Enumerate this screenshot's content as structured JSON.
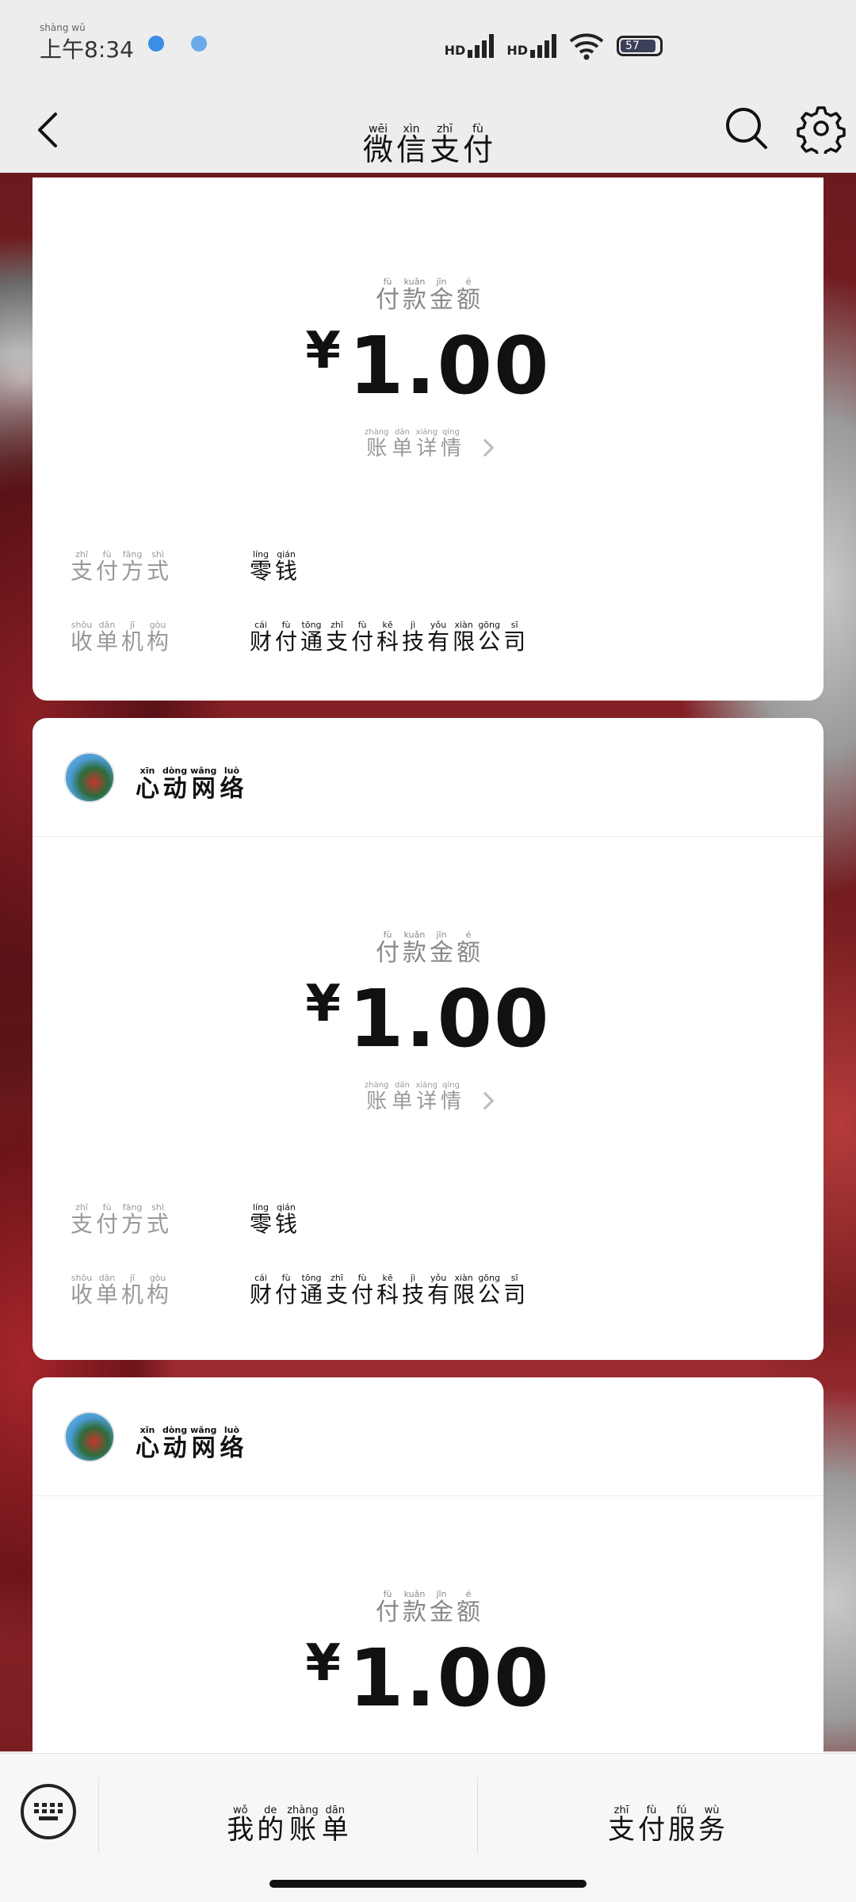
{
  "status_bar": {
    "time_pinyin": "shàng wǔ",
    "time": "上午8:34",
    "signal_1": "HD",
    "signal_2": "HD",
    "battery": "57"
  },
  "nav": {
    "title_chars": [
      {
        "py": "wēi",
        "hz": "微"
      },
      {
        "py": "xìn",
        "hz": "信"
      },
      {
        "py": "zhī",
        "hz": "支"
      },
      {
        "py": "fù",
        "hz": "付"
      }
    ]
  },
  "amount_label_chars": [
    {
      "py": "fù",
      "hz": "付"
    },
    {
      "py": "kuǎn",
      "hz": "款"
    },
    {
      "py": "jīn",
      "hz": "金"
    },
    {
      "py": "é",
      "hz": "额"
    }
  ],
  "bill_detail_chars": [
    {
      "py": "zhàng",
      "hz": "账"
    },
    {
      "py": "dān",
      "hz": "单"
    },
    {
      "py": "xiáng",
      "hz": "详"
    },
    {
      "py": "qíng",
      "hz": "情"
    }
  ],
  "payment_method_label_chars": [
    {
      "py": "zhī",
      "hz": "支"
    },
    {
      "py": "fù",
      "hz": "付"
    },
    {
      "py": "fāng",
      "hz": "方"
    },
    {
      "py": "shì",
      "hz": "式"
    }
  ],
  "payment_method_value_chars": [
    {
      "py": "líng",
      "hz": "零"
    },
    {
      "py": "qián",
      "hz": "钱"
    }
  ],
  "acquirer_label_chars": [
    {
      "py": "shōu",
      "hz": "收"
    },
    {
      "py": "dān",
      "hz": "单"
    },
    {
      "py": "jī",
      "hz": "机"
    },
    {
      "py": "gòu",
      "hz": "构"
    }
  ],
  "acquirer_value_chars": [
    {
      "py": "cái",
      "hz": "财"
    },
    {
      "py": "fù",
      "hz": "付"
    },
    {
      "py": "tōng",
      "hz": "通"
    },
    {
      "py": "zhī",
      "hz": "支"
    },
    {
      "py": "fù",
      "hz": "付"
    },
    {
      "py": "kē",
      "hz": "科"
    },
    {
      "py": "jì",
      "hz": "技"
    },
    {
      "py": "yǒu",
      "hz": "有"
    },
    {
      "py": "xiàn",
      "hz": "限"
    },
    {
      "py": "gōng",
      "hz": "公"
    },
    {
      "py": "sī",
      "hz": "司"
    }
  ],
  "merchant_chars": [
    {
      "py": "xīn",
      "hz": "心"
    },
    {
      "py": "dòng",
      "hz": "动"
    },
    {
      "py": "wǎng",
      "hz": "网"
    },
    {
      "py": "luò",
      "hz": "络"
    }
  ],
  "cards": [
    {
      "amount": "1.00",
      "currency": "¥"
    },
    {
      "amount": "1.00",
      "currency": "¥"
    },
    {
      "amount": "1.00",
      "currency": "¥"
    }
  ],
  "bottom_bar": {
    "my_bills_chars": [
      {
        "py": "wǒ",
        "hz": "我"
      },
      {
        "py": "de",
        "hz": "的"
      },
      {
        "py": "zhàng",
        "hz": "账"
      },
      {
        "py": "dān",
        "hz": "单"
      }
    ],
    "pay_service_chars": [
      {
        "py": "zhī",
        "hz": "支"
      },
      {
        "py": "fù",
        "hz": "付"
      },
      {
        "py": "fú",
        "hz": "服"
      },
      {
        "py": "wù",
        "hz": "务"
      }
    ]
  }
}
